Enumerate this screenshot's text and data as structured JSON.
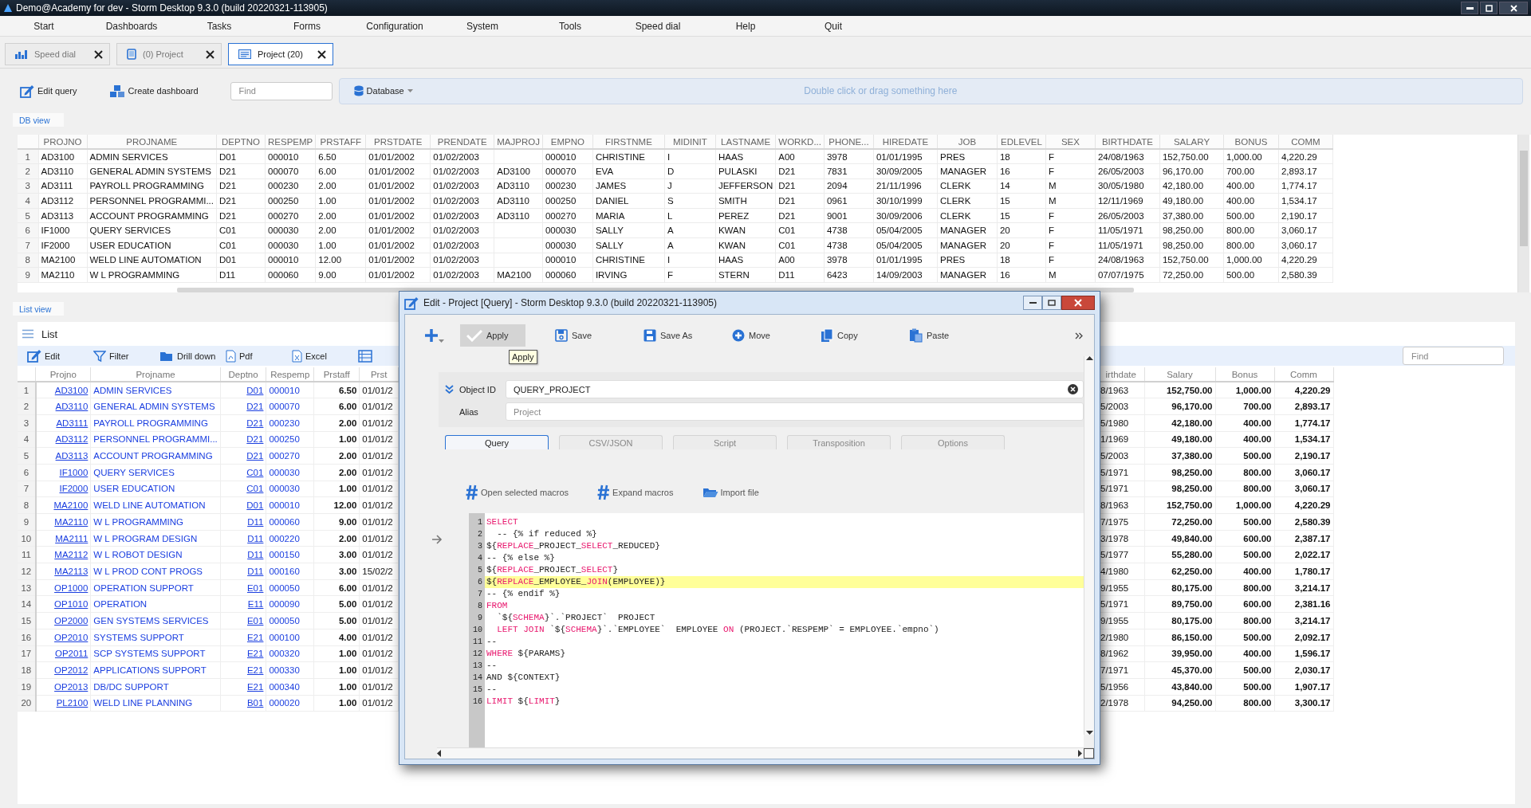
{
  "window": {
    "title": "Demo@Academy for dev -  Storm Desktop 9.3.0 (build 20220321-113905)"
  },
  "menu": [
    "Start",
    "Dashboards",
    "Tasks",
    "Forms",
    "Configuration",
    "System",
    "Tools",
    "Speed dial",
    "Help",
    "Quit"
  ],
  "tabs": [
    {
      "label": "Speed dial",
      "selected": false
    },
    {
      "label": "(0) Project",
      "selected": false
    },
    {
      "label": "Project (20)",
      "selected": true
    }
  ],
  "toolbar": {
    "buttons": [
      "Edit query",
      "Create dashboard"
    ],
    "find": {
      "placeholder": "Find"
    },
    "database": "Database",
    "drop_hint": "Double click or drag something here"
  },
  "db_view": {
    "tab": "DB view",
    "table": {
      "columns": [
        {
          "kind": "index"
        },
        {
          "label": "PROJNO"
        },
        {
          "label": "PROJNAME"
        },
        {
          "label": "DEPTNO"
        },
        {
          "label": "RESPEMP"
        },
        {
          "label": "PRSTAFF"
        },
        {
          "label": "PRSTDATE"
        },
        {
          "label": "PRENDATE"
        },
        {
          "label": "MAJPROJ"
        },
        {
          "label": "EMPNO"
        },
        {
          "label": "FIRSTNME"
        },
        {
          "label": "MIDINIT"
        },
        {
          "label": "LASTNAME"
        },
        {
          "label": "WORKD..."
        },
        {
          "label": "PHONE..."
        },
        {
          "label": "HIREDATE"
        },
        {
          "label": "JOB"
        },
        {
          "label": "EDLEVEL"
        },
        {
          "label": "SEX"
        },
        {
          "label": "BIRTHDATE"
        },
        {
          "label": "SALARY"
        },
        {
          "label": "BONUS"
        },
        {
          "label": "COMM"
        }
      ],
      "rows": [
        [
          "1",
          "AD3100",
          "ADMIN SERVICES",
          "D01",
          "000010",
          "6.50",
          "01/01/2002",
          "01/02/2003",
          null,
          "000010",
          "CHRISTINE",
          "I",
          "HAAS",
          "A00",
          "3978",
          "01/01/1995",
          "PRES",
          "18",
          "F",
          "24/08/1963",
          "152,750.00",
          "1,000.00",
          "4,220.29"
        ],
        [
          "2",
          "AD3110",
          "GENERAL ADMIN SYSTEMS",
          "D21",
          "000070",
          "6.00",
          "01/01/2002",
          "01/02/2003",
          "AD3100",
          "000070",
          "EVA",
          "D",
          "PULASKI",
          "D21",
          "7831",
          "30/09/2005",
          "MANAGER",
          "16",
          "F",
          "26/05/2003",
          "96,170.00",
          "700.00",
          "2,893.17"
        ],
        [
          "3",
          "AD3111",
          "PAYROLL PROGRAMMING",
          "D21",
          "000230",
          "2.00",
          "01/01/2002",
          "01/02/2003",
          "AD3110",
          "000230",
          "JAMES",
          "J",
          "JEFFERSON",
          "D21",
          "2094",
          "21/11/1996",
          "CLERK",
          "14",
          "M",
          "30/05/1980",
          "42,180.00",
          "400.00",
          "1,774.17"
        ],
        [
          "4",
          "AD3112",
          "PERSONNEL PROGRAMMI...",
          "D21",
          "000250",
          "1.00",
          "01/01/2002",
          "01/02/2003",
          "AD3110",
          "000250",
          "DANIEL",
          "S",
          "SMITH",
          "D21",
          "0961",
          "30/10/1999",
          "CLERK",
          "15",
          "M",
          "12/11/1969",
          "49,180.00",
          "400.00",
          "1,534.17"
        ],
        [
          "5",
          "AD3113",
          "ACCOUNT PROGRAMMING",
          "D21",
          "000270",
          "2.00",
          "01/01/2002",
          "01/02/2003",
          "AD3110",
          "000270",
          "MARIA",
          "L",
          "PEREZ",
          "D21",
          "9001",
          "30/09/2006",
          "CLERK",
          "15",
          "F",
          "26/05/2003",
          "37,380.00",
          "500.00",
          "2,190.17"
        ],
        [
          "6",
          "IF1000",
          "QUERY SERVICES",
          "C01",
          "000030",
          "2.00",
          "01/01/2002",
          "01/02/2003",
          null,
          "000030",
          "SALLY",
          "A",
          "KWAN",
          "C01",
          "4738",
          "05/04/2005",
          "MANAGER",
          "20",
          "F",
          "11/05/1971",
          "98,250.00",
          "800.00",
          "3,060.17"
        ],
        [
          "7",
          "IF2000",
          "USER EDUCATION",
          "C01",
          "000030",
          "1.00",
          "01/01/2002",
          "01/02/2003",
          null,
          "000030",
          "SALLY",
          "A",
          "KWAN",
          "C01",
          "4738",
          "05/04/2005",
          "MANAGER",
          "20",
          "F",
          "11/05/1971",
          "98,250.00",
          "800.00",
          "3,060.17"
        ],
        [
          "8",
          "MA2100",
          "WELD LINE AUTOMATION",
          "D01",
          "000010",
          "12.00",
          "01/01/2002",
          "01/02/2003",
          null,
          "000010",
          "CHRISTINE",
          "I",
          "HAAS",
          "A00",
          "3978",
          "01/01/1995",
          "PRES",
          "18",
          "F",
          "24/08/1963",
          "152,750.00",
          "1,000.00",
          "4,220.29"
        ],
        [
          "9",
          "MA2110",
          "W L PROGRAMMING",
          "D11",
          "000060",
          "9.00",
          "01/01/2002",
          "01/02/2003",
          "MA2100",
          "000060",
          "IRVING",
          "F",
          "STERN",
          "D11",
          "6423",
          "14/09/2003",
          "MANAGER",
          "16",
          "M",
          "07/07/1975",
          "72,250.00",
          "500.00",
          "2,580.39"
        ]
      ]
    }
  },
  "list_view": {
    "tab": "List view",
    "title": "List",
    "toolbar": [
      "Edit",
      "Filter",
      "Drill down",
      "Pdf",
      "Excel"
    ],
    "find": {
      "placeholder": "Find"
    },
    "left_table": {
      "columns": [
        {
          "kind": "index"
        },
        {
          "label": "Projno",
          "kind": "link"
        },
        {
          "label": "Projname",
          "kind": "name"
        },
        {
          "label": "Deptno",
          "kind": "link"
        },
        {
          "label": "Respemp",
          "kind": "name"
        },
        {
          "label": "Prstaff",
          "kind": "amount"
        },
        {
          "label": "Prst",
          "kind": "plain"
        }
      ],
      "rows": [
        [
          "1",
          "AD3100",
          "ADMIN SERVICES",
          "D01",
          "000010",
          "6.50",
          "01/01/2"
        ],
        [
          "2",
          "AD3110",
          "GENERAL ADMIN SYSTEMS",
          "D21",
          "000070",
          "6.00",
          "01/01/2"
        ],
        [
          "3",
          "AD3111",
          "PAYROLL PROGRAMMING",
          "D21",
          "000230",
          "2.00",
          "01/01/2"
        ],
        [
          "4",
          "AD3112",
          "PERSONNEL PROGRAMMI...",
          "D21",
          "000250",
          "1.00",
          "01/01/2"
        ],
        [
          "5",
          "AD3113",
          "ACCOUNT PROGRAMMING",
          "D21",
          "000270",
          "2.00",
          "01/01/2"
        ],
        [
          "6",
          "IF1000",
          "QUERY SERVICES",
          "C01",
          "000030",
          "2.00",
          "01/01/2"
        ],
        [
          "7",
          "IF2000",
          "USER EDUCATION",
          "C01",
          "000030",
          "1.00",
          "01/01/2"
        ],
        [
          "8",
          "MA2100",
          "WELD LINE AUTOMATION",
          "D01",
          "000010",
          "12.00",
          "01/01/2"
        ],
        [
          "9",
          "MA2110",
          "W L PROGRAMMING",
          "D11",
          "000060",
          "9.00",
          "01/01/2"
        ],
        [
          "10",
          "MA2111",
          "W L PROGRAM DESIGN",
          "D11",
          "000220",
          "2.00",
          "01/01/2"
        ],
        [
          "11",
          "MA2112",
          "W L ROBOT DESIGN",
          "D11",
          "000150",
          "3.00",
          "01/01/2"
        ],
        [
          "12",
          "MA2113",
          "W L PROD CONT PROGS",
          "D11",
          "000160",
          "3.00",
          "15/02/2"
        ],
        [
          "13",
          "OP1000",
          "OPERATION SUPPORT",
          "E01",
          "000050",
          "6.00",
          "01/01/2"
        ],
        [
          "14",
          "OP1010",
          "OPERATION",
          "E11",
          "000090",
          "5.00",
          "01/01/2"
        ],
        [
          "15",
          "OP2000",
          "GEN SYSTEMS SERVICES",
          "E01",
          "000050",
          "5.00",
          "01/01/2"
        ],
        [
          "16",
          "OP2010",
          "SYSTEMS SUPPORT",
          "E21",
          "000100",
          "4.00",
          "01/01/2"
        ],
        [
          "17",
          "OP2011",
          "SCP SYSTEMS SUPPORT",
          "E21",
          "000320",
          "1.00",
          "01/01/2"
        ],
        [
          "18",
          "OP2012",
          "APPLICATIONS SUPPORT",
          "E21",
          "000330",
          "1.00",
          "01/01/2"
        ],
        [
          "19",
          "OP2013",
          "DB/DC SUPPORT",
          "E21",
          "000340",
          "1.00",
          "01/01/2"
        ],
        [
          "20",
          "PL2100",
          "WELD LINE PLANNING",
          "B01",
          "000020",
          "1.00",
          "01/01/2"
        ]
      ]
    },
    "right_table": {
      "columns": [
        {
          "label": "irthdate",
          "kind": "plain"
        },
        {
          "label": "Salary",
          "kind": "amount"
        },
        {
          "label": "Bonus",
          "kind": "amount"
        },
        {
          "label": "Comm",
          "kind": "amount"
        }
      ],
      "rows": [
        [
          "8/1963",
          "152,750.00",
          "1,000.00",
          "4,220.29"
        ],
        [
          "5/2003",
          "96,170.00",
          "700.00",
          "2,893.17"
        ],
        [
          "5/1980",
          "42,180.00",
          "400.00",
          "1,774.17"
        ],
        [
          "1/1969",
          "49,180.00",
          "400.00",
          "1,534.17"
        ],
        [
          "5/2003",
          "37,380.00",
          "500.00",
          "2,190.17"
        ],
        [
          "5/1971",
          "98,250.00",
          "800.00",
          "3,060.17"
        ],
        [
          "5/1971",
          "98,250.00",
          "800.00",
          "3,060.17"
        ],
        [
          "8/1963",
          "152,750.00",
          "1,000.00",
          "4,220.29"
        ],
        [
          "7/1975",
          "72,250.00",
          "500.00",
          "2,580.39"
        ],
        [
          "3/1978",
          "49,840.00",
          "600.00",
          "2,387.17"
        ],
        [
          "5/1977",
          "55,280.00",
          "500.00",
          "2,022.17"
        ],
        [
          "4/1980",
          "62,250.00",
          "400.00",
          "1,780.17"
        ],
        [
          "9/1955",
          "80,175.00",
          "800.00",
          "3,214.17"
        ],
        [
          "5/1971",
          "89,750.00",
          "600.00",
          "2,381.16"
        ],
        [
          "9/1955",
          "80,175.00",
          "800.00",
          "3,214.17"
        ],
        [
          "2/1980",
          "86,150.00",
          "500.00",
          "2,092.17"
        ],
        [
          "8/1962",
          "39,950.00",
          "400.00",
          "1,596.17"
        ],
        [
          "7/1971",
          "45,370.00",
          "500.00",
          "2,030.17"
        ],
        [
          "5/1956",
          "43,840.00",
          "500.00",
          "1,907.17"
        ],
        [
          "2/1978",
          "94,250.00",
          "800.00",
          "3,300.17"
        ]
      ]
    }
  },
  "dialog": {
    "title": "Edit - Project [Query] -  Storm Desktop 9.3.0 (build 20220321-113905)",
    "toolbar": [
      {
        "label": "Apply",
        "pressed": true
      },
      {
        "label": "Save",
        "pressed": false
      },
      {
        "label": "Save As",
        "pressed": false
      },
      {
        "label": "Move",
        "pressed": false
      },
      {
        "label": "Copy",
        "pressed": false
      },
      {
        "label": "Paste",
        "pressed": false
      }
    ],
    "tooltip": "Apply",
    "object_id": {
      "label": "Object ID",
      "value": "QUERY_PROJECT"
    },
    "alias": {
      "label": "Alias",
      "placeholder": "Project"
    },
    "tabs": [
      {
        "label": "Query",
        "selected": true
      },
      {
        "label": "CSV/JSON",
        "selected": false
      },
      {
        "label": "Script",
        "selected": false
      },
      {
        "label": "Transposition",
        "selected": false
      },
      {
        "label": "Options",
        "selected": false
      }
    ],
    "macros": [
      "Open selected macros",
      "Expand macros",
      "Import file"
    ],
    "code": [
      {
        "number": "1",
        "highlighted": false,
        "tokens": [
          {
            "text": "SELECT",
            "kind": "keyword"
          }
        ]
      },
      {
        "number": "2",
        "highlighted": false,
        "tokens": [
          {
            "text": "  -- {% if reduced %}",
            "kind": "plain"
          }
        ]
      },
      {
        "number": "3",
        "highlighted": false,
        "tokens": [
          {
            "text": "${",
            "kind": "plain"
          },
          {
            "text": "REPLACE",
            "kind": "keyword"
          },
          {
            "text": "_PROJECT_",
            "kind": "plain"
          },
          {
            "text": "SELECT",
            "kind": "keyword"
          },
          {
            "text": "_REDUCED}",
            "kind": "plain"
          }
        ]
      },
      {
        "number": "4",
        "highlighted": false,
        "tokens": [
          {
            "text": "-- {% else %}",
            "kind": "plain"
          }
        ]
      },
      {
        "number": "5",
        "highlighted": false,
        "tokens": [
          {
            "text": "${",
            "kind": "plain"
          },
          {
            "text": "REPLACE",
            "kind": "keyword"
          },
          {
            "text": "_PROJECT_",
            "kind": "plain"
          },
          {
            "text": "SELECT",
            "kind": "keyword"
          },
          {
            "text": "}",
            "kind": "plain"
          }
        ]
      },
      {
        "number": "6",
        "highlighted": true,
        "tokens": [
          {
            "text": "${",
            "kind": "plain"
          },
          {
            "text": "REPLACE",
            "kind": "keyword"
          },
          {
            "text": "_EMPLOYEE_",
            "kind": "plain"
          },
          {
            "text": "JOIN",
            "kind": "keyword"
          },
          {
            "text": "(EMPLOYEE)}",
            "kind": "plain"
          }
        ]
      },
      {
        "number": "7",
        "highlighted": false,
        "tokens": [
          {
            "text": "-- {% endif %}",
            "kind": "plain"
          }
        ]
      },
      {
        "number": "8",
        "highlighted": false,
        "tokens": [
          {
            "text": "FROM",
            "kind": "keyword"
          }
        ]
      },
      {
        "number": "9",
        "highlighted": false,
        "tokens": [
          {
            "text": "  `${",
            "kind": "plain"
          },
          {
            "text": "SCHEMA",
            "kind": "keyword"
          },
          {
            "text": "}`.`PROJECT`  PROJECT",
            "kind": "plain"
          }
        ]
      },
      {
        "number": "10",
        "highlighted": false,
        "tokens": [
          {
            "text": "  LEFT JOIN",
            "kind": "keyword"
          },
          {
            "text": " `${",
            "kind": "plain"
          },
          {
            "text": "SCHEMA",
            "kind": "keyword"
          },
          {
            "text": "}`.`EMPLOYEE`  EMPLOYEE ",
            "kind": "plain"
          },
          {
            "text": "ON",
            "kind": "keyword"
          },
          {
            "text": " (PROJECT.`RESPEMP` = EMPLOYEE.`empno`)",
            "kind": "plain"
          }
        ]
      },
      {
        "number": "11",
        "highlighted": false,
        "tokens": [
          {
            "text": "--",
            "kind": "plain"
          }
        ]
      },
      {
        "number": "12",
        "highlighted": false,
        "tokens": [
          {
            "text": "WHERE",
            "kind": "keyword"
          },
          {
            "text": " ${PARAMS}",
            "kind": "plain"
          }
        ]
      },
      {
        "number": "13",
        "highlighted": false,
        "tokens": [
          {
            "text": "--",
            "kind": "plain"
          }
        ]
      },
      {
        "number": "14",
        "highlighted": false,
        "tokens": [
          {
            "text": "AND ${CONTEXT}",
            "kind": "plain"
          }
        ]
      },
      {
        "number": "15",
        "highlighted": false,
        "tokens": [
          {
            "text": "--",
            "kind": "plain"
          }
        ]
      },
      {
        "number": "16",
        "highlighted": false,
        "tokens": [
          {
            "text": "LIMIT",
            "kind": "keyword"
          },
          {
            "text": " ${",
            "kind": "plain"
          },
          {
            "text": "LIMIT",
            "kind": "keyword"
          },
          {
            "text": "}",
            "kind": "plain"
          }
        ]
      }
    ]
  }
}
